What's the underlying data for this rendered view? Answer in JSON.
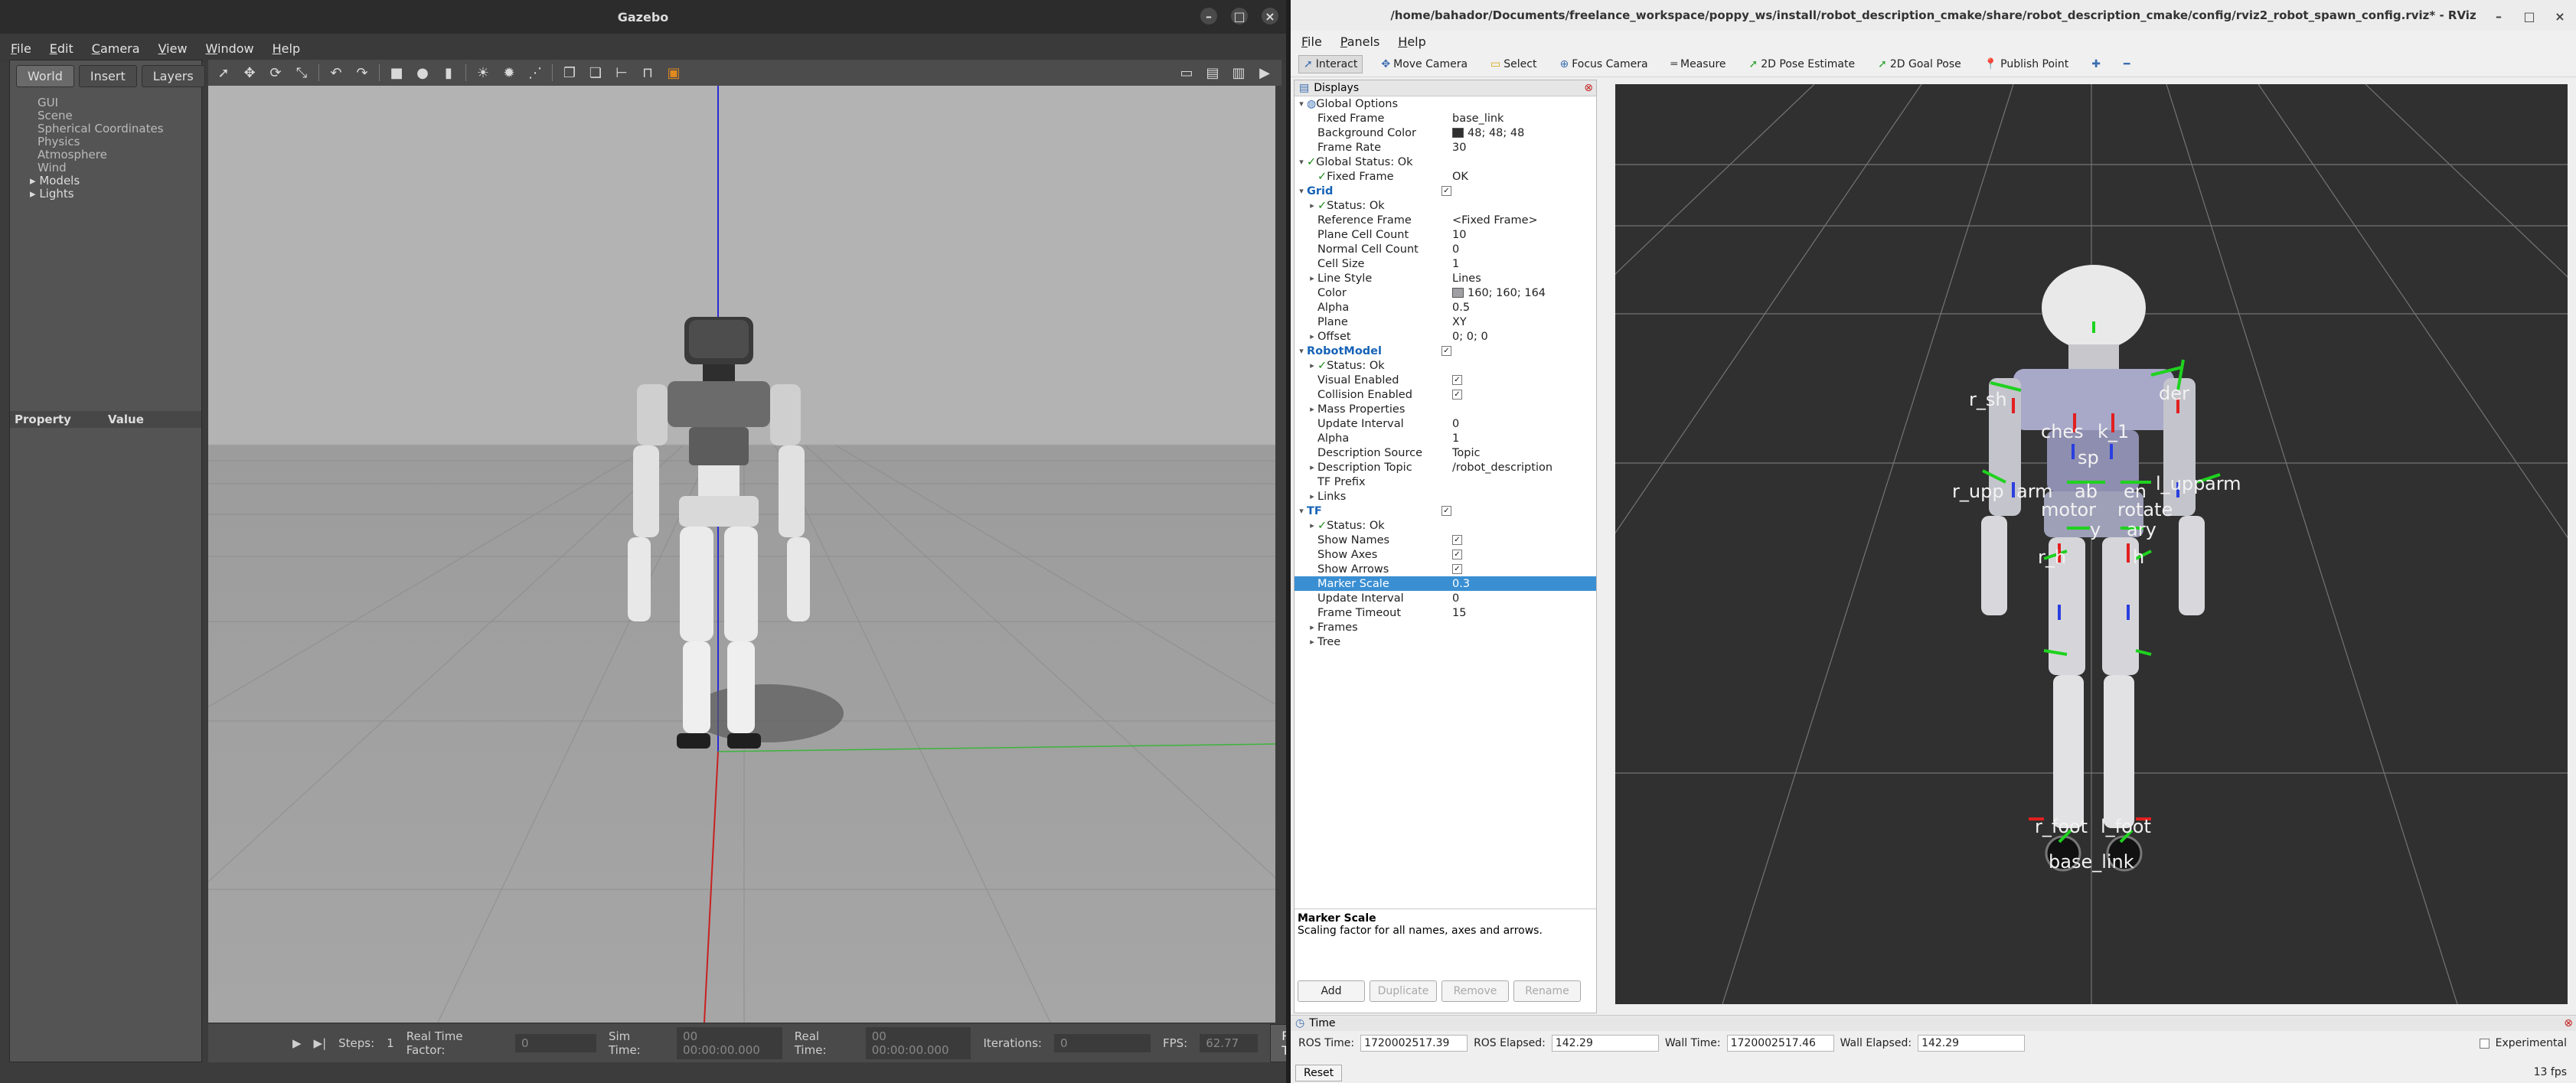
{
  "gazebo": {
    "title": "Gazebo",
    "menu": [
      "File",
      "Edit",
      "Camera",
      "View",
      "Window",
      "Help"
    ],
    "tabs": [
      "World",
      "Insert",
      "Layers"
    ],
    "tree": {
      "leaf_items": [
        "GUI",
        "Scene",
        "Spherical Coordinates",
        "Physics",
        "Atmosphere",
        "Wind"
      ],
      "expandable_items": [
        "Models",
        "Lights"
      ]
    },
    "property_header": {
      "property": "Property",
      "value": "Value"
    },
    "bottom": {
      "steps_label": "Steps:",
      "steps_value": "1",
      "real_time_factor_label": "Real Time Factor:",
      "real_time_factor_value": "0",
      "sim_time_label": "Sim Time:",
      "sim_time_value": "00 00:00:00.000",
      "real_time_label": "Real Time:",
      "real_time_value": "00 00:00:00.000",
      "iterations_label": "Iterations:",
      "iterations_value": "0",
      "fps_label": "FPS:",
      "fps_value": "62.77",
      "reset_time": "Reset Time"
    }
  },
  "rviz": {
    "title": "/home/bahador/Documents/freelance_workspace/poppy_ws/install/robot_description_cmake/share/robot_description_cmake/config/rviz2_robot_spawn_config.rviz* - RViz",
    "menu": [
      "File",
      "Panels",
      "Help"
    ],
    "toolbar": [
      "Interact",
      "Move Camera",
      "Select",
      "Focus Camera",
      "Measure",
      "2D Pose Estimate",
      "2D Goal Pose",
      "Publish Point"
    ],
    "displays_title": "Displays",
    "rows": [
      {
        "k": "Global Options",
        "v": "",
        "indent": 0,
        "arrow": "open",
        "icon": "globe"
      },
      {
        "k": "Fixed Frame",
        "v": "base_link",
        "indent": 1
      },
      {
        "k": "Background Color",
        "v": "48; 48; 48",
        "indent": 1,
        "swatch": "#303030"
      },
      {
        "k": "Frame Rate",
        "v": "30",
        "indent": 1
      },
      {
        "k": "Global Status: Ok",
        "v": "",
        "indent": 0,
        "arrow": "open",
        "ok": true
      },
      {
        "k": "Fixed Frame",
        "v": "OK",
        "indent": 1,
        "ok": true
      },
      {
        "k": "Grid",
        "v": "",
        "indent": 0,
        "arrow": "open",
        "blue": true,
        "check": true
      },
      {
        "k": "Status: Ok",
        "v": "",
        "indent": 1,
        "arrow": "closed",
        "ok": true
      },
      {
        "k": "Reference Frame",
        "v": "<Fixed Frame>",
        "indent": 1
      },
      {
        "k": "Plane Cell Count",
        "v": "10",
        "indent": 1
      },
      {
        "k": "Normal Cell Count",
        "v": "0",
        "indent": 1
      },
      {
        "k": "Cell Size",
        "v": "1",
        "indent": 1
      },
      {
        "k": "Line Style",
        "v": "Lines",
        "indent": 1,
        "arrow": "closed"
      },
      {
        "k": "Color",
        "v": "160; 160; 164",
        "indent": 1,
        "swatch": "#a0a0a4"
      },
      {
        "k": "Alpha",
        "v": "0.5",
        "indent": 1
      },
      {
        "k": "Plane",
        "v": "XY",
        "indent": 1
      },
      {
        "k": "Offset",
        "v": "0; 0; 0",
        "indent": 1,
        "arrow": "closed"
      },
      {
        "k": "RobotModel",
        "v": "",
        "indent": 0,
        "arrow": "open",
        "blue": true,
        "check": true
      },
      {
        "k": "Status: Ok",
        "v": "",
        "indent": 1,
        "arrow": "closed",
        "ok": true
      },
      {
        "k": "Visual Enabled",
        "v": "",
        "indent": 1,
        "check": true
      },
      {
        "k": "Collision Enabled",
        "v": "",
        "indent": 1,
        "check": true
      },
      {
        "k": "Mass Properties",
        "v": "",
        "indent": 1,
        "arrow": "closed"
      },
      {
        "k": "Update Interval",
        "v": "0",
        "indent": 1
      },
      {
        "k": "Alpha",
        "v": "1",
        "indent": 1
      },
      {
        "k": "Description Source",
        "v": "Topic",
        "indent": 1
      },
      {
        "k": "Description Topic",
        "v": "/robot_description",
        "indent": 1,
        "arrow": "closed"
      },
      {
        "k": "TF Prefix",
        "v": "",
        "indent": 1
      },
      {
        "k": "Links",
        "v": "",
        "indent": 1,
        "arrow": "closed"
      },
      {
        "k": "TF",
        "v": "",
        "indent": 0,
        "arrow": "open",
        "blue": true,
        "check": true
      },
      {
        "k": "Status: Ok",
        "v": "",
        "indent": 1,
        "arrow": "closed",
        "ok": true
      },
      {
        "k": "Show Names",
        "v": "",
        "indent": 1,
        "check": true
      },
      {
        "k": "Show Axes",
        "v": "",
        "indent": 1,
        "check": true
      },
      {
        "k": "Show Arrows",
        "v": "",
        "indent": 1,
        "check": true
      },
      {
        "k": "Marker Scale",
        "v": "0.3",
        "indent": 1,
        "selected": true
      },
      {
        "k": "Update Interval",
        "v": "0",
        "indent": 1
      },
      {
        "k": "Frame Timeout",
        "v": "15",
        "indent": 1
      },
      {
        "k": "Frames",
        "v": "",
        "indent": 1,
        "arrow": "closed"
      },
      {
        "k": "Tree",
        "v": "",
        "indent": 1,
        "arrow": "closed"
      }
    ],
    "desc_title": "Marker Scale",
    "desc_text": "Scaling factor for all names, axes and arrows.",
    "buttons": {
      "add": "Add",
      "duplicate": "Duplicate",
      "remove": "Remove",
      "rename": "Rename"
    },
    "time": {
      "title": "Time",
      "ros_time_label": "ROS Time:",
      "ros_time": "1720002517.39",
      "ros_elapsed_label": "ROS Elapsed:",
      "ros_elapsed": "142.29",
      "wall_time_label": "Wall Time:",
      "wall_time": "1720002517.46",
      "wall_elapsed_label": "Wall Elapsed:",
      "wall_elapsed": "142.29",
      "experimental": "Experimental",
      "reset": "Reset",
      "fps": "13 fps"
    },
    "tf_labels": [
      "r_sh",
      "der",
      "ches",
      "k_1",
      "sp",
      "r_upp",
      "arm",
      "ab",
      "en",
      "l_upp",
      "arm",
      "motor",
      "rotate",
      "y",
      "ary",
      "r_h",
      "h",
      "r_foot",
      "l_foot",
      "base_link"
    ]
  },
  "colors": {
    "rviz_select": "#3a8fd3",
    "gazebo_bg": "#3c3c3c",
    "rviz_bg": "#303030"
  }
}
